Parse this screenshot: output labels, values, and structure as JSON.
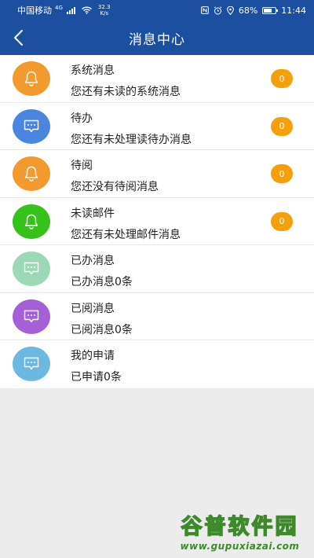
{
  "status_bar": {
    "carrier": "中国移动",
    "network": "4G",
    "speed_value": "32.3",
    "speed_unit": "K/s",
    "battery": "68%",
    "time": "11:44"
  },
  "header": {
    "title": "消息中心",
    "back_icon": "chevron-left-icon"
  },
  "messages": [
    {
      "name": "系统消息",
      "desc": "您还有未读的系统消息",
      "badge": "0",
      "icon": "bell-icon",
      "color": "#f39a2e"
    },
    {
      "name": "待办",
      "desc": "您还有未处理读待办消息",
      "badge": "0",
      "icon": "chat-bubble-icon",
      "color": "#4a86e0"
    },
    {
      "name": "待阅",
      "desc": "您还没有待阅消息",
      "badge": "0",
      "icon": "bell-icon",
      "color": "#f39a2e"
    },
    {
      "name": "未读邮件",
      "desc": "您还有未处理邮件消息",
      "badge": "0",
      "icon": "bell-icon",
      "color": "#35c21a"
    },
    {
      "name": "已办消息",
      "desc": "已办消息0条",
      "icon": "chat-bubble-icon",
      "color": "#9ad8b8"
    },
    {
      "name": "已阅消息",
      "desc": "已阅消息0条",
      "icon": "chat-bubble-icon",
      "color": "#a560d8"
    },
    {
      "name": "我的申请",
      "desc": "已申请0条",
      "icon": "chat-bubble-icon",
      "color": "#6bb8e0"
    }
  ],
  "watermark": {
    "title": "谷普软件园",
    "url": "www.gupuxiazai.com"
  }
}
